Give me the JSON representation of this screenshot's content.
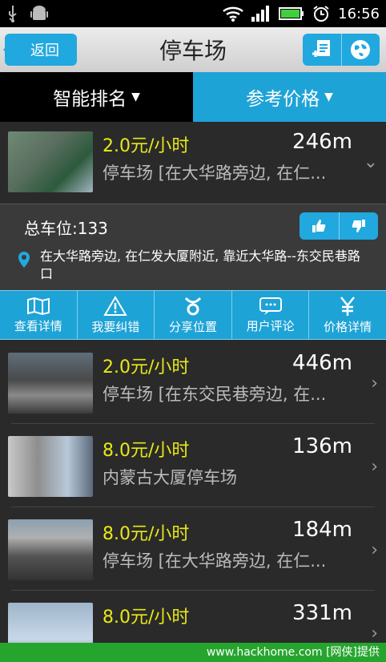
{
  "statusbar": {
    "time": "16:56"
  },
  "titlebar": {
    "back_label": "返回",
    "title": "停车场"
  },
  "tabs": [
    {
      "label": "智能排名"
    },
    {
      "label": "参考价格"
    }
  ],
  "items": [
    {
      "price": "2.0元/小时",
      "distance": "246m",
      "name": "停车场 [在大华路旁边, 在仁..."
    },
    {
      "price": "2.0元/小时",
      "distance": "446m",
      "name": "停车场 [在东交民巷旁边, 在..."
    },
    {
      "price": "8.0元/小时",
      "distance": "136m",
      "name": "内蒙古大厦停车场"
    },
    {
      "price": "8.0元/小时",
      "distance": "184m",
      "name": "停车场 [在大华路旁边, 在仁..."
    },
    {
      "price": "8.0元/小时",
      "distance": "331m",
      "name": ""
    }
  ],
  "detail": {
    "total_spaces": "总车位:133",
    "address": "在大华路旁边, 在仁发大厦附近, 靠近大华路--东交民巷路口"
  },
  "actions": [
    {
      "label": "查看详情",
      "icon": "map-icon"
    },
    {
      "label": "我要纠错",
      "icon": "warning-icon"
    },
    {
      "label": "分享位置",
      "icon": "share-icon"
    },
    {
      "label": "用户评论",
      "icon": "comment-icon"
    },
    {
      "label": "价格详情",
      "icon": "yen-icon"
    }
  ],
  "watermark": "www.hackhome.com [网侠]提供",
  "colors": {
    "accent": "#21a8df",
    "price": "#e8e818",
    "background": "#2a2a2a"
  }
}
